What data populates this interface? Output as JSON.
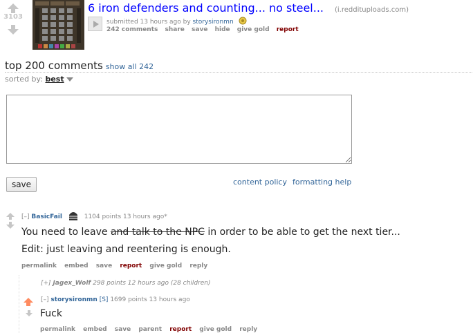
{
  "post": {
    "score": "3103",
    "title": "6 iron defenders and counting... no steel...",
    "domain": "(i.reddituploads.com)",
    "tagline_prefix": "submitted 13 hours ago by",
    "author": "storysironmn",
    "buttons": {
      "comments": "242 comments",
      "share": "share",
      "save": "save",
      "hide": "hide",
      "give_gold": "give gold",
      "report": "report"
    }
  },
  "comments_header": {
    "title": "top 200 comments",
    "show_all": "show all 242",
    "sorted_label": "sorted by:",
    "sorted_value": "best"
  },
  "reply_form": {
    "textarea_value": "",
    "save_label": "save",
    "content_policy": "content policy",
    "formatting_help": "formatting help"
  },
  "comments": [
    {
      "collapse": "[–]",
      "author": "BasicFail",
      "meta": "1104 points 13 hours ago*",
      "body_pre": "You need to leave",
      "body_strike": "and talk to the NPC",
      "body_post": "in order to be able to get the next tier...",
      "body_line2": "Edit: just leaving and reentering is enough.",
      "buttons": {
        "permalink": "permalink",
        "embed": "embed",
        "save": "save",
        "report": "report",
        "give_gold": "give gold",
        "reply": "reply"
      }
    },
    {
      "collapse": "[+]",
      "author": "Jagex_Wolf",
      "meta": "298 points 12 hours ago (28 children)"
    },
    {
      "collapse": "[–]",
      "author": "storysironmn",
      "op_tag": "[S]",
      "meta": "1699 points 13 hours ago",
      "body": "Fuck",
      "buttons": {
        "permalink": "permalink",
        "embed": "embed",
        "save": "save",
        "parent": "parent",
        "report": "report",
        "give_gold": "give gold",
        "reply": "reply"
      }
    }
  ],
  "colors": {
    "link": "#0000ff",
    "user": "#336699",
    "report": "#800000",
    "upvoted": "#ff8b60"
  }
}
